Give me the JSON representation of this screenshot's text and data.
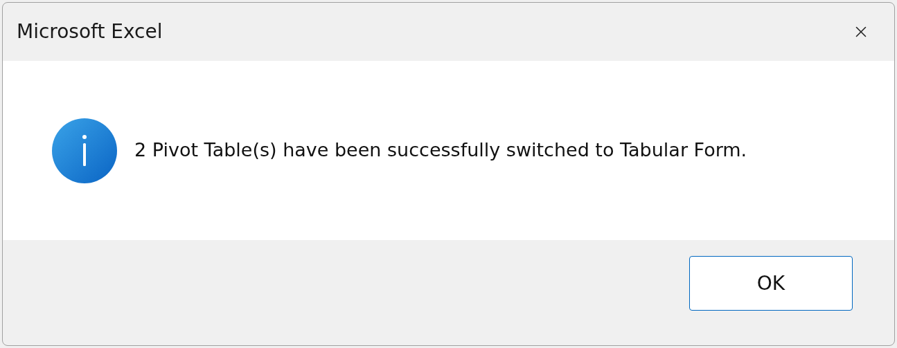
{
  "window": {
    "title": "Microsoft Excel"
  },
  "message": "2 Pivot Table(s) have been successfully switched to Tabular Form.",
  "buttons": [
    "OK"
  ]
}
